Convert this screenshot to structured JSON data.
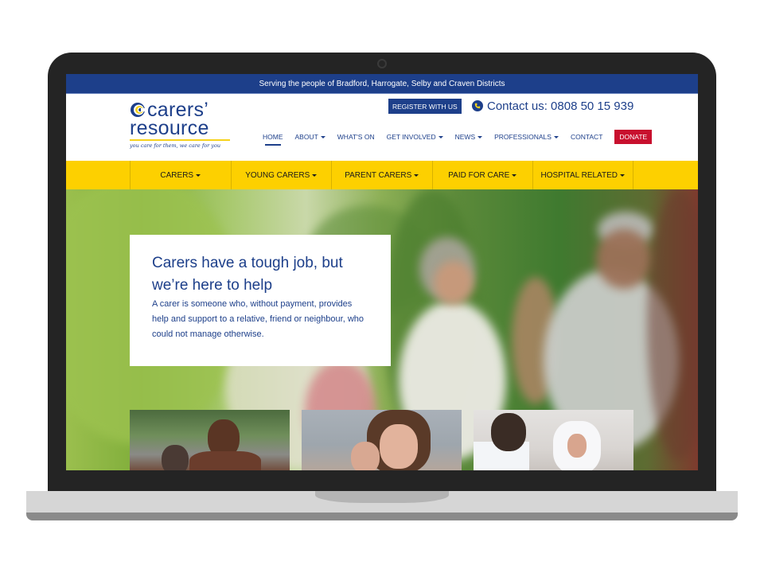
{
  "topbar": {
    "text": "Serving the people of Bradford, Harrogate, Selby and Craven Districts"
  },
  "logo": {
    "line1": "carers’",
    "line2": "resource",
    "tagline": "you care for them, we care for you",
    "brand_color": "#1d3f8a",
    "accent_color": "#f6d21b"
  },
  "header": {
    "register_label": "REGISTER WITH US",
    "contact_label": "Contact us: 0808 50 15 939",
    "contact_icon": "phone-icon"
  },
  "mainnav": {
    "items": [
      {
        "label": "HOME",
        "active": true,
        "dropdown": false
      },
      {
        "label": "ABOUT",
        "active": false,
        "dropdown": true
      },
      {
        "label": "WHAT'S ON",
        "active": false,
        "dropdown": false
      },
      {
        "label": "GET INVOLVED",
        "active": false,
        "dropdown": true
      },
      {
        "label": "NEWS",
        "active": false,
        "dropdown": true
      },
      {
        "label": "PROFESSIONALS",
        "active": false,
        "dropdown": true
      },
      {
        "label": "CONTACT",
        "active": false,
        "dropdown": false
      }
    ],
    "donate_label": "DONATE",
    "donate_color": "#c8102e"
  },
  "yellowmenu": {
    "color": "#fdd000",
    "items": [
      {
        "label": "CARERS"
      },
      {
        "label": "YOUNG CARERS"
      },
      {
        "label": "PARENT CARERS"
      },
      {
        "label": "PAID FOR CARE"
      },
      {
        "label": "HOSPITAL RELATED"
      }
    ]
  },
  "hero": {
    "title": "Carers have a tough job, but we’re here to help",
    "text": "A carer is someone who, without payment, provides help and support to a relative, friend or neighbour, who could not manage otherwise.",
    "image": "older-couple-walking-in-garden-photo"
  },
  "tiles": [
    {
      "image": "older-couple-outdoors-photo"
    },
    {
      "image": "young-carer-hugging-child-photo"
    },
    {
      "image": "doctor-with-elderly-patient-photo"
    }
  ]
}
